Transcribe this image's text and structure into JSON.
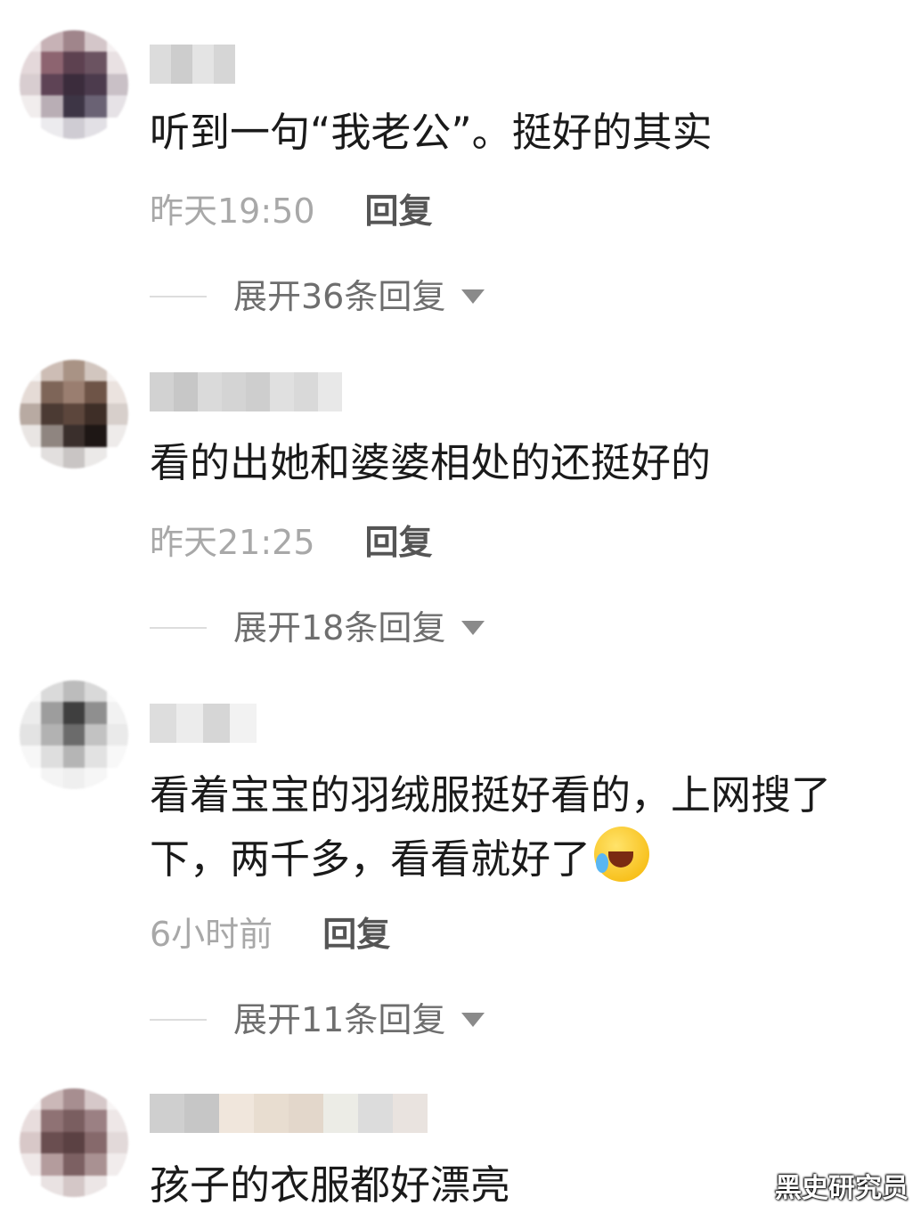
{
  "comments": [
    {
      "text": "听到一句“我老公”。挺好的其实",
      "time": "昨天19:50",
      "reply_label": "回复",
      "expand_label": "展开36条回复",
      "avatar_colors": [
        "#f3eced",
        "#c7b2b6",
        "#a0858b",
        "#d4c6c9",
        "#f6f1f2",
        "#e4d8da",
        "#8d6470",
        "#5d4150",
        "#6b5361",
        "#e9e1e3",
        "#d8cdd0",
        "#5e4355",
        "#3b2c3c",
        "#4c3b4d",
        "#c9c0c6",
        "#f1eded",
        "#b9aeb5",
        "#3d3545",
        "#6a6274",
        "#e6e2e6",
        "#ffffff",
        "#ecebee",
        "#cfccd3",
        "#e2e0e5",
        "#ffffff"
      ],
      "username_colors": [
        "#dcdcdc",
        "#cdcdcd",
        "#e4e4e4",
        "#d6d6d6"
      ]
    },
    {
      "text": "看的出她和婆婆相处的还挺好的",
      "time": "昨天21:25",
      "reply_label": "回复",
      "expand_label": "展开18条回复",
      "avatar_colors": [
        "#f7f5f4",
        "#cdbdb5",
        "#a99385",
        "#d2c6bf",
        "#f7f4f3",
        "#e5dbd6",
        "#7e6558",
        "#9a7e70",
        "#6e5447",
        "#ebe3df",
        "#b8aaa2",
        "#4b3a33",
        "#5c463c",
        "#3e2e27",
        "#d7cfcb",
        "#e9e5e3",
        "#8f8580",
        "#3a2f2c",
        "#1e1715",
        "#eeebea",
        "#ffffff",
        "#e2dfde",
        "#c9c5c4",
        "#ebe9e8",
        "#ffffff"
      ],
      "username_colors": [
        "#d2d2d2",
        "#c7c7c7",
        "#dadada",
        "#d4d4d4",
        "#cecece",
        "#e0e0e0",
        "#d9d9d9",
        "#e8e8e8"
      ]
    },
    {
      "text": "看着宝宝的羽绒服挺好看的，上网搜了下，两千多，看看就好了",
      "time": "6小时前",
      "reply_label": "回复",
      "expand_label": "展开11条回复",
      "avatar_colors": [
        "#fafafa",
        "#dadada",
        "#bcbcbc",
        "#d9d9d9",
        "#fbfbfb",
        "#ececec",
        "#9d9d9d",
        "#3f3f3f",
        "#8f8f8f",
        "#f2f2f2",
        "#e3e3e3",
        "#b2b2b2",
        "#6b6b6b",
        "#c2c2c2",
        "#eaeaea",
        "#f7f7f7",
        "#dedede",
        "#b5b5b5",
        "#e2e2e2",
        "#f8f8f8",
        "#ffffff",
        "#f4f4f4",
        "#efefef",
        "#f6f6f6",
        "#ffffff"
      ],
      "username_colors": [
        "#dddddd",
        "#ececec",
        "#d6d6d6",
        "#f2f2f2"
      ]
    },
    {
      "text": "孩子的衣服都好漂亮",
      "time": "",
      "reply_label": "",
      "expand_label": "",
      "avatar_colors": [
        "#f8f5f5",
        "#cbb8b8",
        "#a78e90",
        "#d6c8c9",
        "#f8f5f5",
        "#e8dddd",
        "#8f7274",
        "#7a5e60",
        "#9b8083",
        "#eee7e7",
        "#d8c8c8",
        "#6a4e50",
        "#5b4143",
        "#86696b",
        "#e2d9d9",
        "#efe8e8",
        "#b49c9d",
        "#7c6062",
        "#a99192",
        "#f1ecec",
        "#ffffff",
        "#e9e2e2",
        "#d4c7c7",
        "#ece6e6",
        "#ffffff"
      ],
      "username_colors": [
        "#cfcfcf",
        "#c6c6c6",
        "#f0e6dc",
        "#e8ddd0",
        "#e3d7cb",
        "#ecece6",
        "#dcdcdc",
        "#e9e3df"
      ]
    }
  ],
  "watermark": "黑史研究员",
  "emoji_name": "rofl-emoji"
}
